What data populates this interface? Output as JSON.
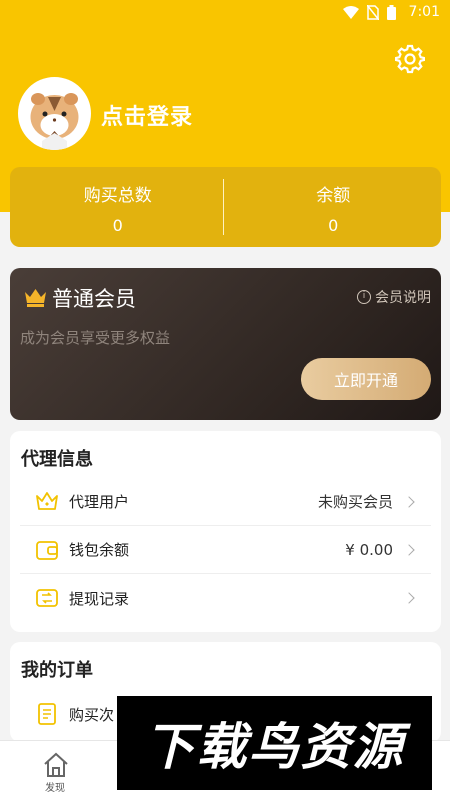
{
  "status_bar": {
    "time": "7:01"
  },
  "profile": {
    "login_text": "点击登录"
  },
  "stats": {
    "purchase_total_label": "购买总数",
    "purchase_total_value": "0",
    "balance_label": "余额",
    "balance_value": "0"
  },
  "vip": {
    "title": "普通会员",
    "info_label": "会员说明",
    "description": "成为会员享受更多权益",
    "open_button": "立即开通"
  },
  "agent_section": {
    "title": "代理信息",
    "rows": [
      {
        "label": "代理用户",
        "value": "未购买会员",
        "icon": "crown-icon"
      },
      {
        "label": "钱包余额",
        "value": "¥ 0.00",
        "icon": "wallet-icon"
      },
      {
        "label": "提现记录",
        "value": "",
        "icon": "withdraw-icon"
      }
    ]
  },
  "orders_section": {
    "title": "我的订单",
    "rows": [
      {
        "label": "购买次",
        "icon": "order-icon"
      }
    ]
  },
  "bottom_nav": {
    "discover_label": "发现"
  },
  "watermark": {
    "text": "下载鸟资源"
  },
  "colors": {
    "brand_yellow": "#f9c500",
    "stats_card": "#e2b20e",
    "vip_dark": "#2d2420",
    "vip_gold": "#d4ab74"
  }
}
